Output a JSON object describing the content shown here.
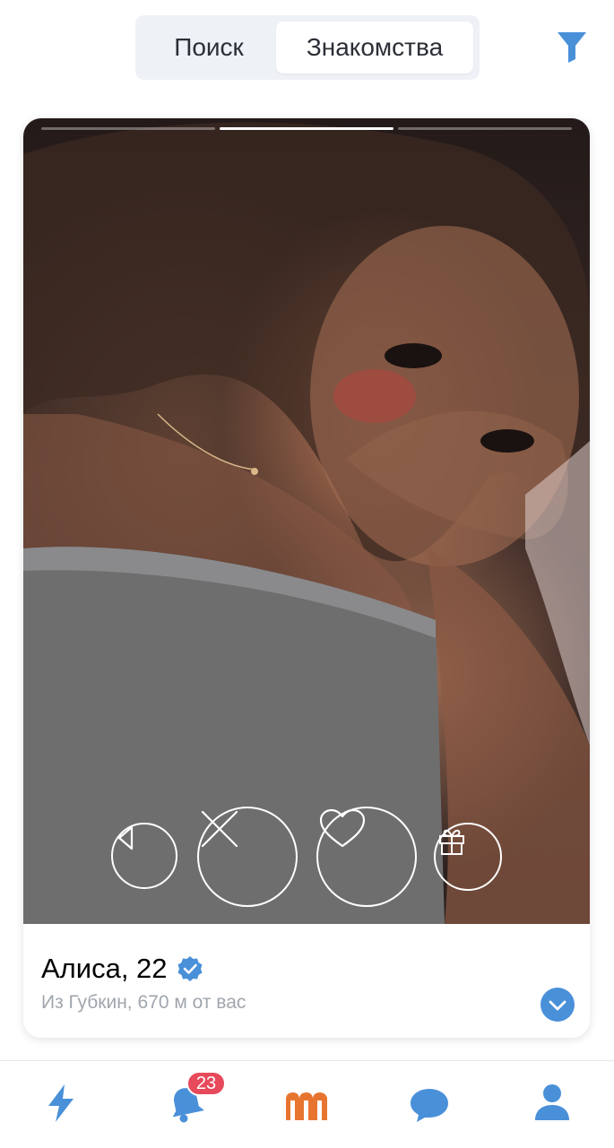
{
  "tabs": {
    "search_label": "Поиск",
    "dating_label": "Знакомства",
    "active": "Знакомства"
  },
  "icons": {
    "filter": "filter-icon",
    "back": "back-icon",
    "dislike": "close-icon",
    "like": "heart-icon",
    "gift": "gift-icon",
    "verified": "verified-icon",
    "expand": "chevron-down-icon",
    "nav": [
      "lightning-icon",
      "bell-icon",
      "dating-logo-icon",
      "chat-icon",
      "profile-icon"
    ]
  },
  "photo_progress": {
    "total": 3,
    "current": 2
  },
  "profile": {
    "name_age": "Алиса, 22",
    "location": "Из Губкин, 670 м от вас",
    "verified": true
  },
  "nav": {
    "notifications_badge": "23"
  },
  "colors": {
    "accent": "#4a90d9",
    "brand": "#e8752f",
    "badge": "#e64a5b"
  }
}
